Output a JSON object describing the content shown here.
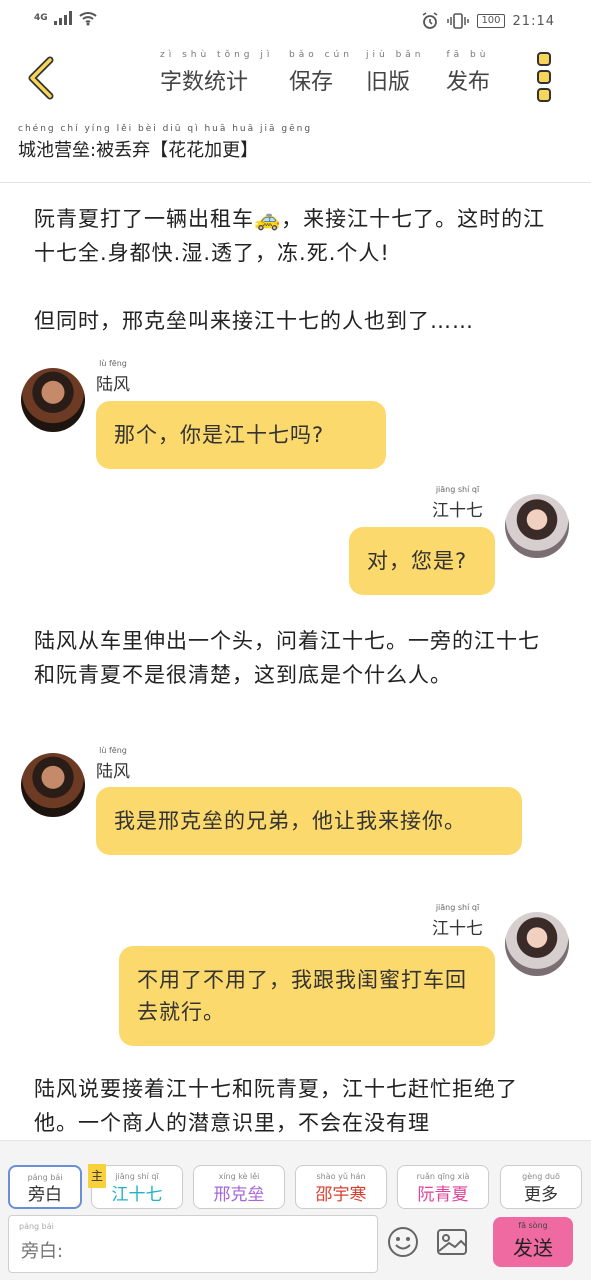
{
  "status": {
    "network": "4G",
    "battery": "100",
    "time": "21:14"
  },
  "toolbar": {
    "items": [
      {
        "py": "zì shù tǒng jì",
        "label": "字数统计"
      },
      {
        "py": "bǎo cún",
        "label": "保存"
      },
      {
        "py": "jiù bǎn",
        "label": "旧版"
      },
      {
        "py": "fā bù",
        "label": "发布"
      }
    ]
  },
  "title": {
    "py": "chéng chí yíng lěi  bèi diū qì  huā huā jiā gēng",
    "text": "城池营垒:被丢弃【花花加更】"
  },
  "story": [
    {
      "type": "narration",
      "text": "阮青夏打了一辆出租车🚕，来接江十七了。这时的江十七全.身都快.湿.透了，冻.死.个人!"
    },
    {
      "type": "narration",
      "text": "但同时，邢克垒叫来接江十七的人也到了……"
    },
    {
      "type": "message",
      "speaker": "陆风",
      "speaker_py": "lù fēng",
      "side": "left",
      "text": "那个，你是江十七吗?"
    },
    {
      "type": "message",
      "speaker": "江十七",
      "speaker_py": "jiāng shí qī",
      "side": "right",
      "text": "对，您是?"
    },
    {
      "type": "narration",
      "text": "陆风从车里伸出一个头，问着江十七。一旁的江十七和阮青夏不是很清楚，这到底是个什么人。"
    },
    {
      "type": "message",
      "speaker": "陆风",
      "speaker_py": "lù fēng",
      "side": "left",
      "text": "我是邢克垒的兄弟，他让我来接你。"
    },
    {
      "type": "message",
      "speaker": "江十七",
      "speaker_py": "jiāng shí qī",
      "side": "right",
      "text": "不用了不用了，我跟我闺蜜打车回去就行。"
    },
    {
      "type": "narration",
      "text": "陆风说要接着江十七和阮青夏，江十七赶忙拒绝了他。一个商人的潜意识里，不会在没有理"
    }
  ],
  "roles": [
    {
      "py": "páng bái",
      "label": "旁白",
      "color": "#333333",
      "active": true
    },
    {
      "py": "jiāng shí qī",
      "label": "江十七",
      "color": "#1fb3c4",
      "badge": "主"
    },
    {
      "py": "xíng kè lěi",
      "label": "邢克垒",
      "color": "#a566d6"
    },
    {
      "py": "shào yǔ hán",
      "label": "邵宇寒",
      "color": "#d94030"
    },
    {
      "py": "ruǎn qīng xià",
      "label": "阮青夏",
      "color": "#e0449a"
    },
    {
      "py": "gèng duō",
      "label": "更多",
      "color": "#333333"
    }
  ],
  "composer": {
    "py": "páng bái",
    "placeholder": "旁白:",
    "send_py": "fā sòng",
    "send_label": "发送"
  }
}
